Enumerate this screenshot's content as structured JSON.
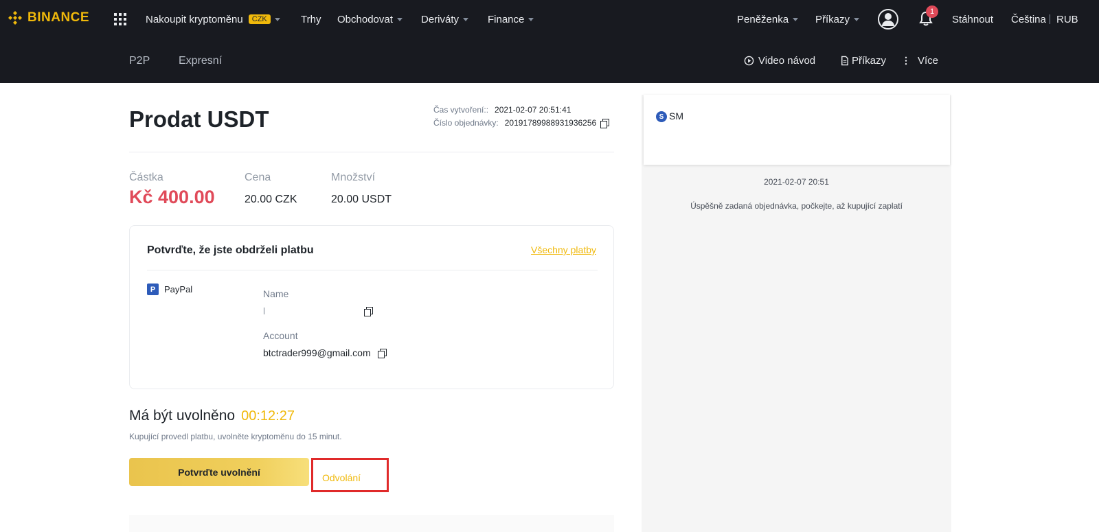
{
  "brand": {
    "name": "BINANCE",
    "color": "#f0b90b"
  },
  "topnav": {
    "buy_crypto": "Nakoupit kryptoměnu",
    "currency_badge": "CZK",
    "markets": "Trhy",
    "trade": "Obchodovat",
    "derivatives": "Deriváty",
    "finance": "Finance",
    "wallet": "Peněženka",
    "orders": "Příkazy",
    "notif_count": "1",
    "download": "Stáhnout",
    "language": "Čeština",
    "currency": "RUB"
  },
  "subnav": {
    "tab_p2p": "P2P",
    "tab_express": "Expresní",
    "video_guide": "Video návod",
    "orders": "Příkazy",
    "more": "Více"
  },
  "order": {
    "title": "Prodat USDT",
    "created_label": "Čas vytvoření::",
    "created_value": "2021-02-07 20:51:41",
    "order_no_label": "Číslo objednávky:",
    "order_no_value": "20191789988931936256",
    "amount_label": "Částka",
    "amount_value": "Kč 400.00",
    "price_label": "Cena",
    "price_value": "20.00 CZK",
    "quantity_label": "Množství",
    "quantity_value": "20.00 USDT"
  },
  "payment": {
    "title": "Potvrďte, že jste obdrželi platbu",
    "all_payments": "Všechny platby",
    "method": "PayPal",
    "name_label": "Name",
    "name_value": "l",
    "account_label": "Account",
    "account_value": "btctrader999@gmail.com"
  },
  "release": {
    "title": "Má být uvolněno",
    "timer": "00:12:27",
    "hint": "Kupující provedl platbu, uvolněte kryptoměnu do 15 minut.",
    "confirm_label": "Potvrďte uvolnění",
    "appeal_label": "Odvolání"
  },
  "chat": {
    "avatar_letter": "S",
    "user": "SM",
    "time": "2021-02-07 20:51",
    "message": "Úspěšně zadaná objednávka, počkejte, až kupující zaplatí"
  }
}
